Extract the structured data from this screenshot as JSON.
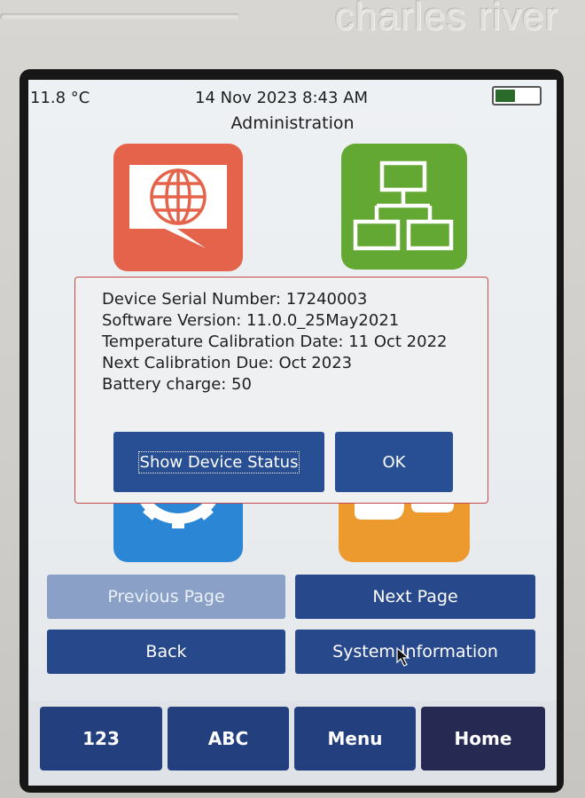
{
  "device": {
    "brand": "charles river"
  },
  "status_bar": {
    "temperature": "11.8 °C",
    "datetime": "14 Nov 2023 8:43 AM",
    "battery_level": 0.5,
    "battery_icon": "battery-icon"
  },
  "screen": {
    "title": "Administration"
  },
  "tiles": [
    {
      "icon": "globe-chat-icon",
      "color": "#e4634a"
    },
    {
      "icon": "network-icon",
      "color": "#62a832"
    },
    {
      "icon": "gear-icon",
      "color": "#2b86d6"
    },
    {
      "icon": "users-icon",
      "color": "#ec9a2e"
    }
  ],
  "dialog": {
    "lines": [
      "Device Serial Number: 17240003",
      "Software Version: 11.0.0_25May2021",
      "Temperature Calibration Date: 11 Oct 2022",
      "Next Calibration Due: Oct 2023",
      "Battery charge: 50"
    ],
    "show_status_label": "Show Device Status",
    "ok_label": "OK"
  },
  "navigation": {
    "previous_label": "Previous Page",
    "next_label": "Next Page",
    "back_label": "Back",
    "system_info_label": "System Information"
  },
  "bottom_bar": {
    "numeric_label": "123",
    "alpha_label": "ABC",
    "menu_label": "Menu",
    "home_label": "Home"
  },
  "colors": {
    "button_blue": "#284f93",
    "button_disabled": "#8aa0c6",
    "home_button": "#262a52",
    "dialog_border": "#c94a4a"
  }
}
